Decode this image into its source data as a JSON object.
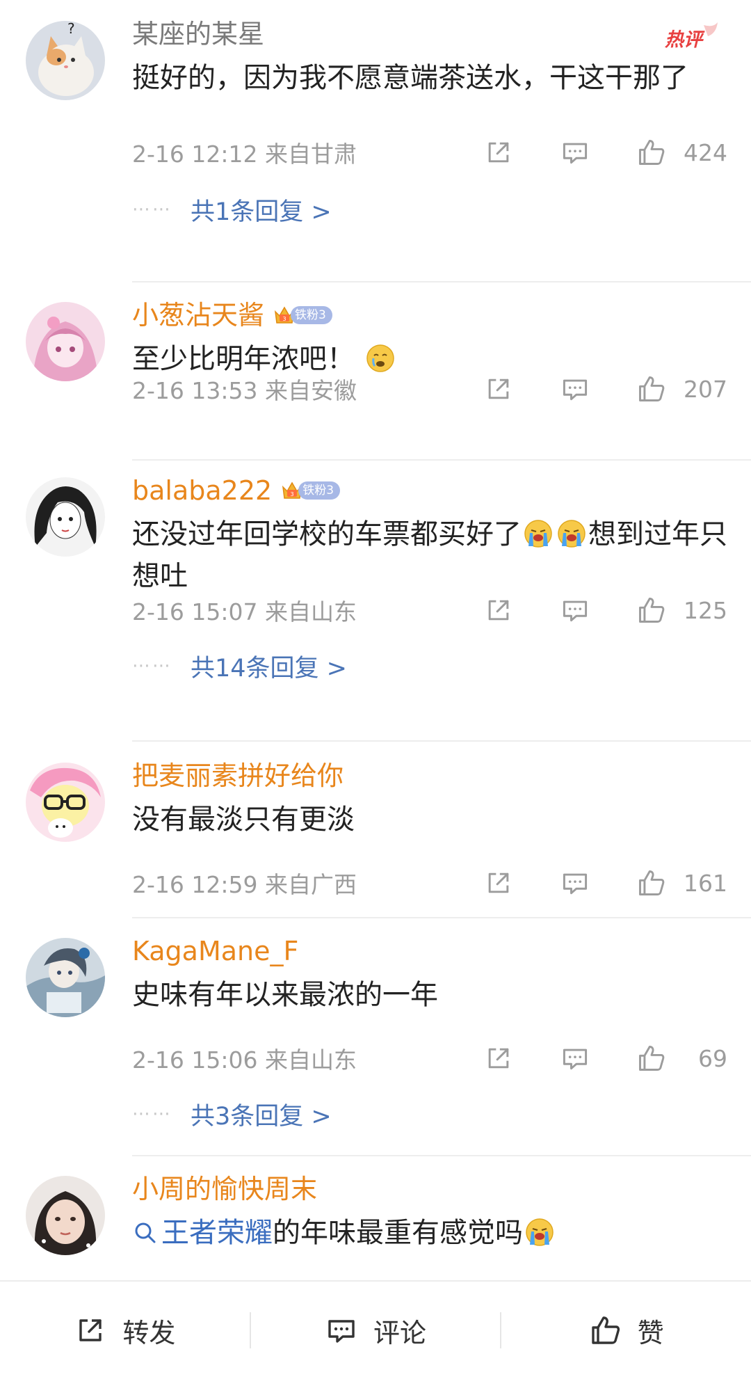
{
  "hot_tag": "热评",
  "comments": [
    {
      "username": "某座的某星",
      "text": "挺好的，因为我不愿意端茶送水，干这干那了",
      "time": "2-16 12:12 来自甘肃",
      "likes": "424",
      "replies": "共1条回复 >"
    },
    {
      "username": "小葱沾天酱",
      "badge": "铁粉3",
      "text": "至少比明年浓吧！",
      "emoji": "crying-face",
      "time": "2-16 13:53 来自安徽",
      "likes": "207"
    },
    {
      "username": "balaba222",
      "badge": "铁粉3",
      "text_a": "还没过年回学校的车票都买好了",
      "text_b": "想到过年只想吐",
      "emoji": "loudly-crying-face",
      "time": "2-16 15:07 来自山东",
      "likes": "125",
      "replies": "共14条回复 >"
    },
    {
      "username": "把麦丽素拼好给你",
      "text": "没有最淡只有更淡",
      "time": "2-16 12:59 来自广西",
      "likes": "161"
    },
    {
      "username": "KagaMane_F",
      "text": "史味有年以来最浓的一年",
      "time": "2-16 15:06 来自山东",
      "likes": "69",
      "replies": "共3条回复 >"
    },
    {
      "username": "小周的愉快周末",
      "link": "王者荣耀",
      "text": "的年味最重有感觉吗",
      "emoji": "loudly-crying-face"
    }
  ],
  "reply_dots": "⋯⋯",
  "bottom_bar": {
    "repost": "转发",
    "comment": "评论",
    "like": "赞"
  },
  "colors": {
    "username_orange": "#e8861c",
    "link_blue": "#3a6dbf",
    "meta_grey": "#9c9c9c"
  }
}
